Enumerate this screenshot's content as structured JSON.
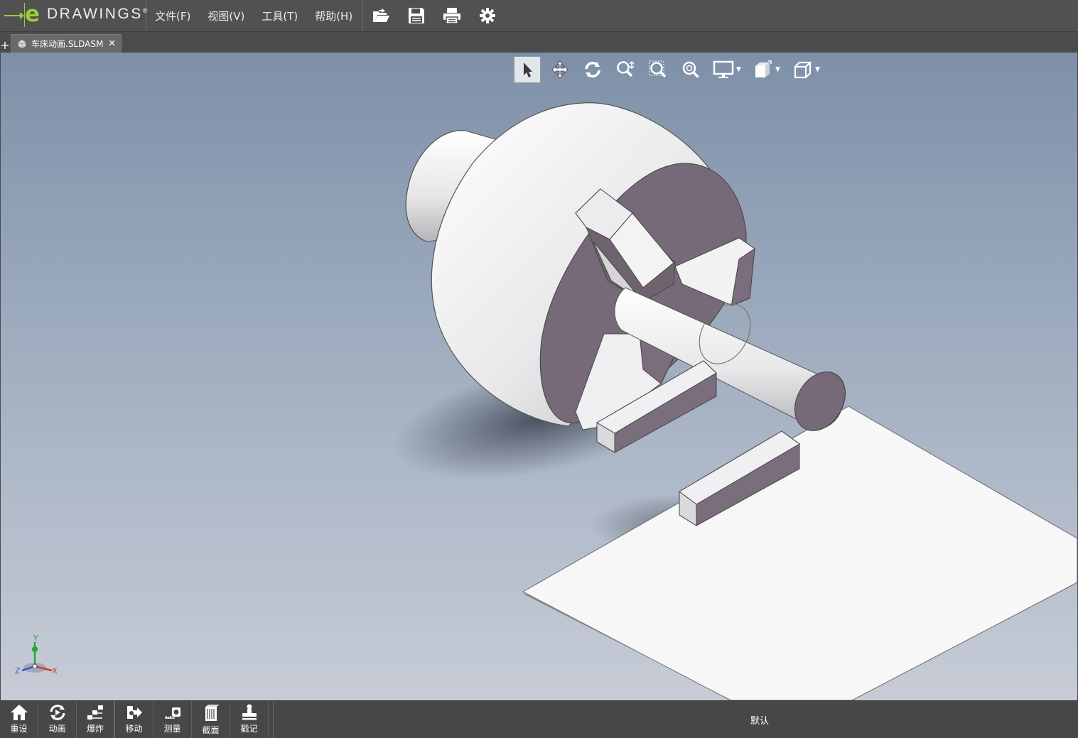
{
  "app": {
    "logo_text": "DRAWINGS",
    "logo_letter": "e",
    "registered_mark": "®"
  },
  "menu": {
    "file": "文件(F)",
    "view": "视图(V)",
    "tools": "工具(T)",
    "help": "帮助(H)"
  },
  "quick_tools": [
    "open-icon",
    "save-icon",
    "print-icon",
    "settings-icon"
  ],
  "tab": {
    "plus": "+",
    "label": "车床动画.SLDASM",
    "close": "✕"
  },
  "view_toolbar": [
    "select-icon",
    "pan-icon",
    "rotate-icon",
    "zoom-to-fit-icon",
    "zoom-to-area-icon",
    "zoom-icon",
    "display-style-icon",
    "views-icon",
    "standard-view-icon"
  ],
  "triad": {
    "x": "X",
    "y": "Y",
    "z": "Z"
  },
  "bottom_tools": {
    "reset": "重设",
    "animate": "动画",
    "explode": "爆炸",
    "move": "移动",
    "measure": "测量",
    "section": "截面",
    "stamp": "戳记"
  },
  "config_name": "默认",
  "colors": {
    "accent_green": "#9ccc3d",
    "chrome_dark": "#515151",
    "part_light": "#f0f0f2",
    "part_face": "#7a6b7b"
  }
}
